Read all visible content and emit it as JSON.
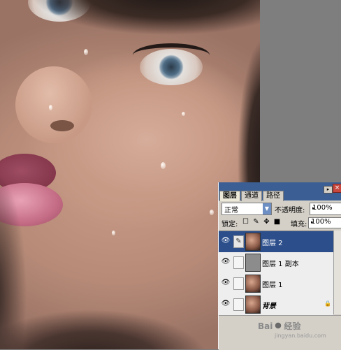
{
  "panel": {
    "tabs": [
      {
        "label": "图层",
        "active": true
      },
      {
        "label": "通道",
        "active": false
      },
      {
        "label": "路径",
        "active": false
      }
    ],
    "blend_mode": "正常",
    "opacity_label": "不透明度:",
    "opacity_value": "100%",
    "lock_label": "锁定:",
    "fill_label": "填充:",
    "fill_value": "100%",
    "layers": [
      {
        "name": "图层 2",
        "selected": true,
        "visible": true,
        "thumb": "face"
      },
      {
        "name": "图层 1 副本",
        "selected": false,
        "visible": true,
        "thumb": "gray"
      },
      {
        "name": "图层 1",
        "selected": false,
        "visible": true,
        "thumb": "face"
      },
      {
        "name": "背景",
        "selected": false,
        "visible": true,
        "thumb": "face",
        "locked": true
      }
    ]
  },
  "watermark": {
    "brand": "Bai",
    "brand2": "经验",
    "sub": "jingyan.baidu.com"
  },
  "colors": {
    "panel_title_bar": "#3b5f95",
    "selected_layer": "#2c4f8c",
    "panel_bg": "#d4d0c8",
    "workspace": "#7e7e7e"
  },
  "icons": [
    "eye-icon",
    "brush-icon",
    "move-icon",
    "lock-icon",
    "dropdown-arrow-icon",
    "panel-menu-icon",
    "close-icon"
  ]
}
